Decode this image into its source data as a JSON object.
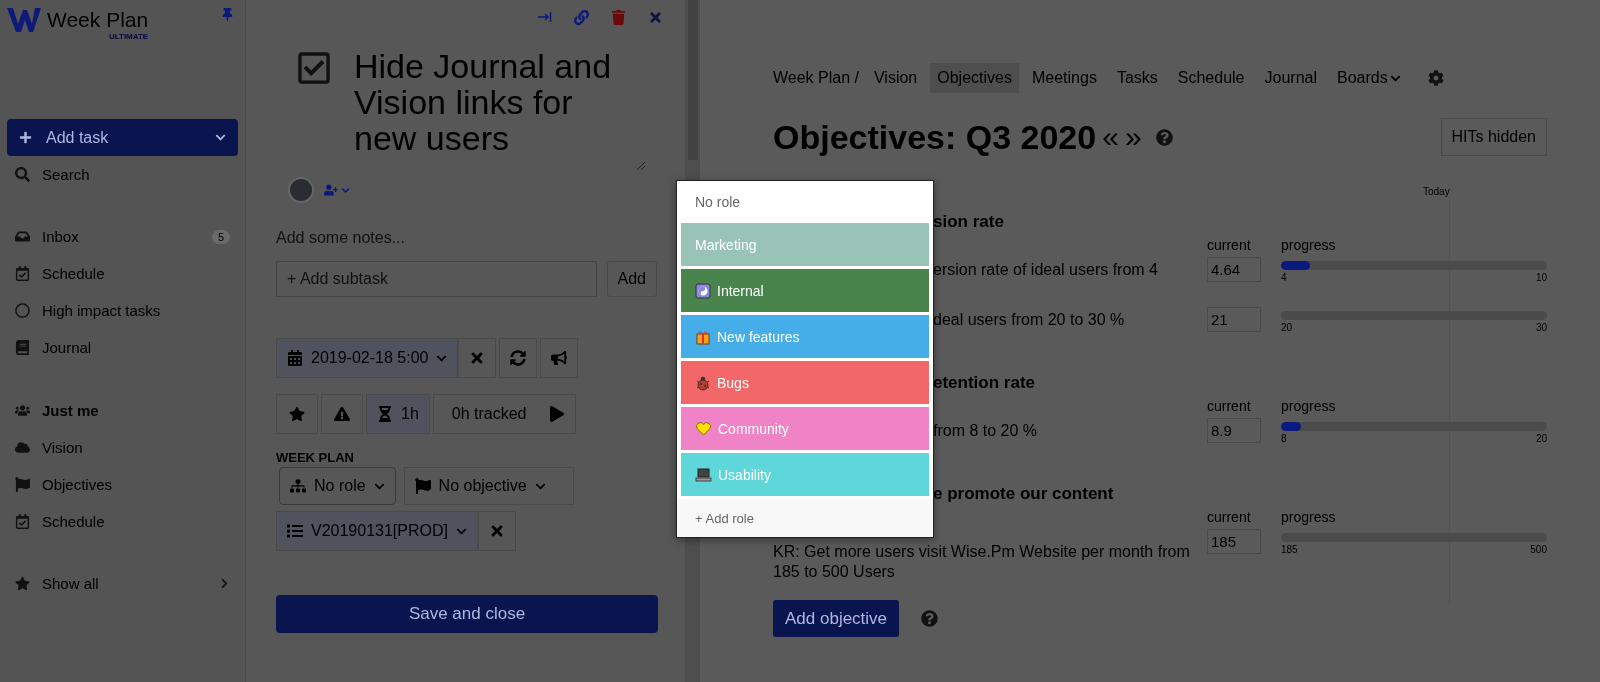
{
  "sidebar": {
    "logo": {
      "name": "Week Plan",
      "edition": "ULTIMATE"
    },
    "add_task": {
      "label": "Add task"
    },
    "search": {
      "label": "Search"
    },
    "items": [
      {
        "label": "Inbox",
        "badge": "5"
      },
      {
        "label": "Schedule"
      },
      {
        "label": "High impact tasks"
      },
      {
        "label": "Journal"
      }
    ],
    "team": {
      "label": "Just me"
    },
    "team_items": [
      {
        "label": "Vision"
      },
      {
        "label": "Objectives"
      },
      {
        "label": "Schedule"
      }
    ],
    "show_all": {
      "label": "Show all"
    }
  },
  "task": {
    "title": "Hide Journal and Vision links for new users",
    "notes_placeholder": "Add some notes...",
    "subtask_placeholder": "+ Add subtask",
    "add_button": "Add",
    "date": "2019-02-18 5:00",
    "duration": "1h",
    "tracked": "0h tracked",
    "section": "WEEK PLAN",
    "role": "No role",
    "objective": "No objective",
    "list": "V20190131[PROD]",
    "save": "Save and close"
  },
  "nav": {
    "root": "Week Plan /",
    "links": [
      {
        "label": "Vision",
        "selected": false
      },
      {
        "label": "Objectives",
        "selected": true
      },
      {
        "label": "Meetings",
        "selected": false
      },
      {
        "label": "Tasks",
        "selected": false
      },
      {
        "label": "Schedule",
        "selected": false
      },
      {
        "label": "Journal",
        "selected": false
      },
      {
        "label": "Boards",
        "selected": false,
        "dropdown": true
      }
    ]
  },
  "heading": "Objectives: Q3 2020",
  "prev": "«",
  "next": "»",
  "hits_button": "HITs hidden",
  "today": "Today",
  "objective_groups": [
    {
      "title": "sion rate",
      "covered": true,
      "current_label": "current",
      "progress_label": "progress",
      "krs": [
        {
          "text": "ersion rate of ideal users from 4",
          "covered": true,
          "current": "4.64",
          "min": "4",
          "max": "10",
          "level": 0.11
        },
        {
          "text": "deal users from 20 to 30 %",
          "covered": true,
          "current": "21",
          "min": "20",
          "max": "30"
        }
      ]
    },
    {
      "title": "etention rate",
      "covered": true,
      "current_label": "current",
      "progress_label": "progress",
      "krs": [
        {
          "text": "from 8 to 20 %",
          "covered": true,
          "current": "8.9",
          "min": "8",
          "max": "20",
          "level": 0.075
        }
      ]
    },
    {
      "title": "e promote our content",
      "covered": true,
      "current_label": "current",
      "progress_label": "progress",
      "krs": [
        {
          "text": "KR: Get more users visit Wise.Pm Website per month from 185 to 500 Users",
          "covered": false,
          "current": "185",
          "min": "185",
          "max": "500"
        }
      ]
    }
  ],
  "add_objective": "Add objective",
  "role_menu": {
    "none": "No role",
    "roles": [
      {
        "label": "Marketing",
        "color": "#9ac3b8"
      },
      {
        "label": "Internal",
        "color": "#4a844d"
      },
      {
        "label": "New features",
        "color": "#45aee8"
      },
      {
        "label": "Bugs",
        "color": "#f26767"
      },
      {
        "label": "Community",
        "color": "#f083c6"
      },
      {
        "label": "Usability",
        "color": "#5fd6da"
      }
    ],
    "add": "+ Add role"
  }
}
